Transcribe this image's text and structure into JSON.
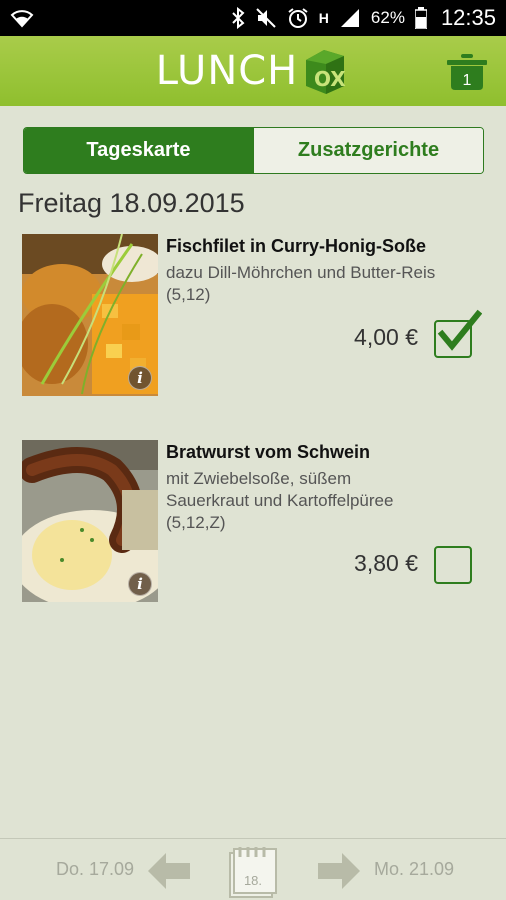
{
  "status_bar": {
    "battery_percent": "62%",
    "time": "12:35",
    "network": "H",
    "icons": [
      "wifi-icon",
      "bluetooth-icon",
      "mute-icon",
      "alarm-icon",
      "signal-icon",
      "battery-icon"
    ]
  },
  "header": {
    "logo_text": "LUNCH",
    "logo_box_text": "OX",
    "cart_count": "1",
    "colors": {
      "bar": "#9cc63c",
      "accent": "#2e7d1e"
    }
  },
  "tabs": [
    {
      "label": "Tageskarte",
      "active": true
    },
    {
      "label": "Zusatzgerichte",
      "active": false
    }
  ],
  "date_heading": "Freitag 18.09.2015",
  "items": [
    {
      "title": "Fischfilet in Curry-Honig-Soße",
      "description_lines": [
        "dazu Dill-Möhrchen und Butter-Reis",
        "(5,12)"
      ],
      "price": "4,00 €",
      "checked": true
    },
    {
      "title": "Bratwurst vom Schwein",
      "description_lines": [
        "mit Zwiebelsoße, süßem",
        "Sauerkraut und Kartoffelpüree",
        "(5,12,Z)"
      ],
      "price": "3,80 €",
      "checked": false
    }
  ],
  "info_label": "i",
  "bottom_nav": {
    "prev_label": "Do. 17.09",
    "next_label": "Mo. 21.09",
    "calendar_day": "18."
  }
}
